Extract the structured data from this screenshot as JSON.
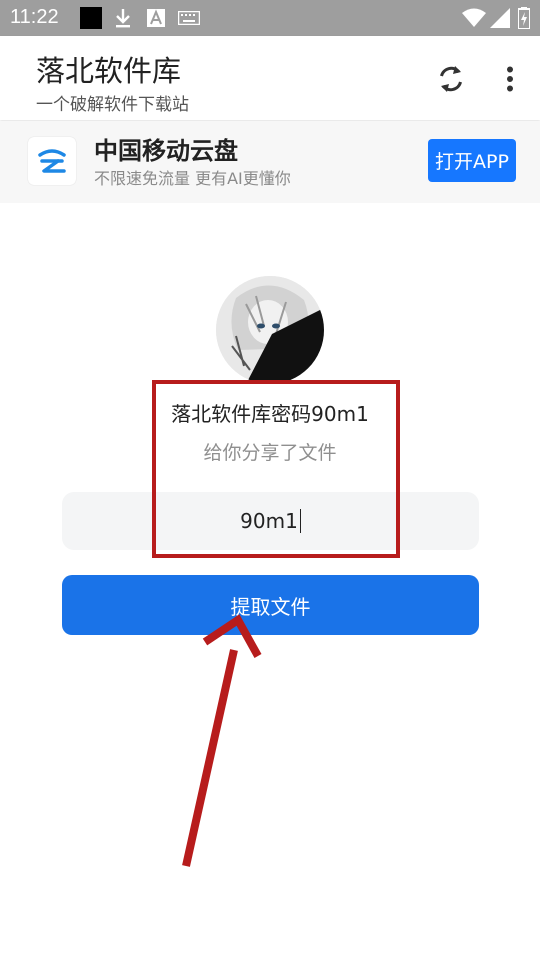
{
  "status_bar": {
    "time": "11:22",
    "icons": [
      "black-square-icon",
      "download-icon",
      "font-a-icon",
      "keyboard-icon",
      "wifi-icon",
      "signal-icon",
      "battery-charging-icon"
    ]
  },
  "app_bar": {
    "title": "落北软件库",
    "subtitle": "一个破解软件下载站",
    "actions": [
      "refresh-icon",
      "more-vert-icon"
    ]
  },
  "ad": {
    "title": "中国移动云盘",
    "description": "不限速免流量 更有AI更懂你",
    "button_label": "打开APP",
    "logo_icon": "cloud-logo-icon"
  },
  "share": {
    "title": "落北软件库密码90m1",
    "subtitle": "给你分享了文件",
    "code_value": "90m1",
    "extract_label": "提取文件"
  },
  "colors": {
    "status_bar": "#9e9e9e",
    "primary_button": "#1a73e8",
    "ad_button": "#1677ff",
    "annotation": "#b71c1c"
  }
}
